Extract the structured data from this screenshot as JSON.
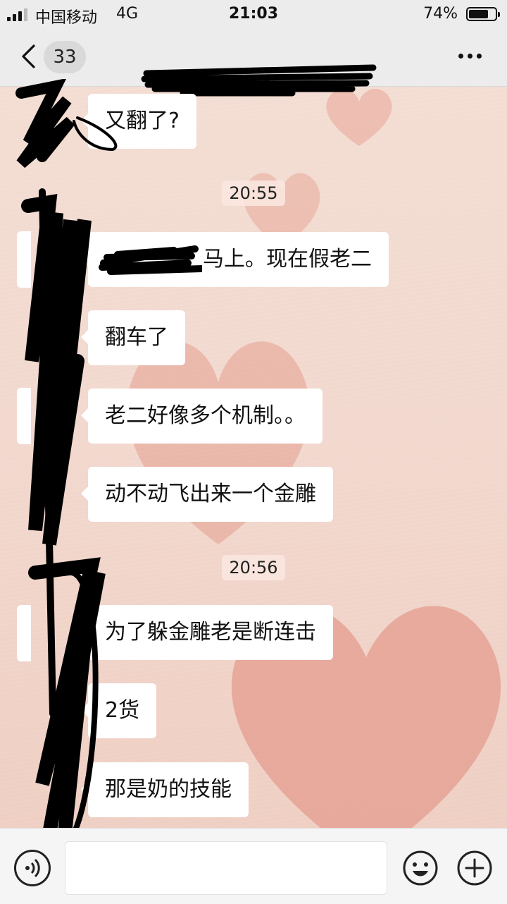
{
  "status_bar": {
    "carrier": "中国移动",
    "network": "4G",
    "time": "21:03",
    "battery_percent": "74%",
    "battery_level": 0.74
  },
  "nav": {
    "unread_count": "33",
    "back_icon": "chevron-left-icon",
    "more_icon": "ellipsis-icon"
  },
  "messages": [
    {
      "text": "又翻了?"
    },
    {
      "text": "马上。现在假老二"
    },
    {
      "text": "翻车了"
    },
    {
      "text": "老二好像多个机制。。"
    },
    {
      "text": "动不动飞出来一个金雕"
    },
    {
      "text": "为了躲金雕老是断连击"
    },
    {
      "text": "2货"
    },
    {
      "text": "那是奶的技能"
    }
  ],
  "timestamps": [
    "20:55",
    "20:56"
  ],
  "input_bar": {
    "voice_icon": "voice-icon",
    "emoji_icon": "emoji-icon",
    "plus_icon": "plus-icon",
    "text_value": ""
  },
  "colors": {
    "bubble": "#ffffff",
    "wallpaper": "#f2dcd2",
    "heart": "#e8a496",
    "bar": "#ececec"
  }
}
